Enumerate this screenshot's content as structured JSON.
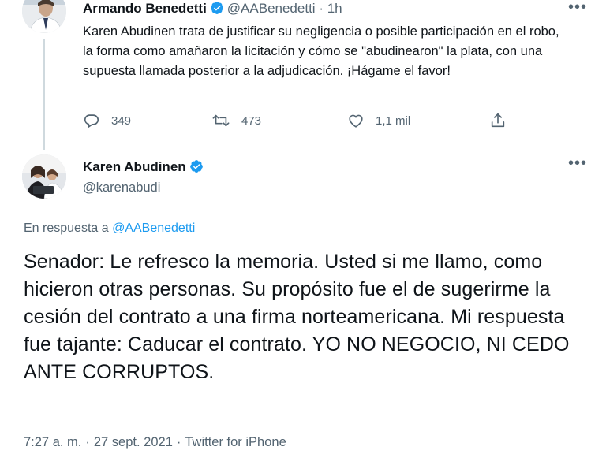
{
  "tweet1": {
    "author_name": "Armando Benedetti",
    "author_handle": "@AABenedetti",
    "separator": "·",
    "time": "1h",
    "text": "Karen Abudinen trata de justificar su negligencia o posible participación en el robo, la forma como amañaron la licitación y cómo se \"abudinearon\" la plata, con una supuesta llamada posterior a la adjudicación. ¡Hágame el favor!",
    "reply_count": "349",
    "retweet_count": "473",
    "like_count": "1,1 mil"
  },
  "tweet2": {
    "author_name": "Karen Abudinen",
    "author_handle": "@karenabudi",
    "reply_prefix": "En respuesta a",
    "reply_target": "@AABenedetti",
    "text": "Senador: Le refresco la memoria. Usted si me llamo, como hicieron otras personas. Su propósito fue el de sugerirme la cesión del contrato a una firma norteamericana. Mi respuesta fue tajante: Caducar el contrato. YO NO NEGOCIO, NI CEDO ANTE CORRUPTOS.",
    "time": "7:27 a. m.",
    "date": "27 sept. 2021",
    "source": "Twitter for iPhone",
    "separator": "·"
  },
  "colors": {
    "verified_blue": "#1d9bf0",
    "secondary_text": "#536471",
    "primary_text": "#0f1419",
    "link": "#1d9bf0",
    "thread_line": "#cfd9de"
  },
  "icons": [
    "verified-badge-icon",
    "more-options-icon",
    "reply-icon",
    "retweet-icon",
    "like-icon",
    "share-icon"
  ]
}
